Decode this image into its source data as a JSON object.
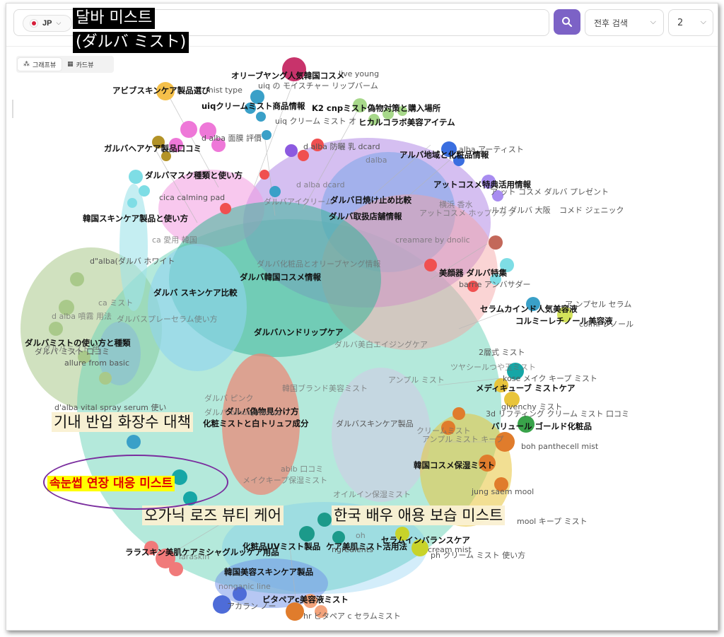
{
  "header": {
    "country_code": "JP",
    "query_line1": "달바 미스트",
    "query_line2": "(ダルバ ミスト)",
    "period_select": "전후 검색",
    "count_select": "2"
  },
  "view_toggle": {
    "graph_view": "그래프뷰",
    "card_view": "카드뷰"
  },
  "colors": {
    "accent": "#7c62c6",
    "highlight_text": "#e00000",
    "highlight_bg": "#ffff00",
    "circle_outline": "#7a2d9e"
  },
  "graph": {
    "bold_labels": [
      "オリーブヤング人気韓国コスメ",
      "アビブスキンケア製品選び",
      "uiqクリームミスト商品情報",
      "K2 cnpミスト偽物対策と購入場所",
      "ヒカルコラボ美容アイテム",
      "ガルバヘアケア製品口コミ",
      "アルバ地域と化粧品情報",
      "ダルバマスク種類と使い方",
      "アットコスメ特典活用情報",
      "韓国スキンケア製品と使い方",
      "ダルバ日焼け止め比較",
      "ダルバ取扱店舗情報",
      "ダルバ化粧品とオリーブヤング情報",
      "ダルバ韓国コスメ情報",
      "美顔器 ダルバ特集",
      "ダルバ スキンケア比較",
      "セラムカインド人気美容液",
      "コルミーレチノール美容液",
      "ダルバハンドリップケア",
      "ダルバミストの使い方と種類",
      "ダルバ美白エイジングケア",
      "メディキューブ ミストケア",
      "ダルバ偽物見分け方",
      "化粧ミストと白トリュフ成分",
      "ダルバスキンケア製品",
      "バリュール ゴールド化粧品",
      "韓国コスメ保湿ミスト",
      "オイルイン保湿ミスト",
      "セラムインバランスケア",
      "ララスキン美肌ケアミシャグルッケア用品",
      "化粧品UVミスト製品",
      "ケア美肌ミスト活用法",
      "韓国美容スキンケア製品",
      "ビタペアc美容液ミスト"
    ],
    "normal_labels": [
      "live young",
      "uiq の モイスチャー リップバーム",
      "mist type",
      "uiq クリーム ミスト オ",
      "d alba 面膜 評價",
      "d alba 防曬 乳 dcard",
      "alba アーティスト",
      "ア ット コスメ ダルバ プレゼント",
      "ルガ ダルバ 大阪",
      "コメド ジェニック",
      "cica calming pad",
      "d\"alba(ダルバ ホワイト",
      "barrie アンバサダー",
      "ア ンプセル セラム",
      "colmi レノール",
      "2層式 ミスト",
      "kose メイク キープ ミスト",
      "givenchy ミスト",
      "3d リフティング クリーム ミスト 口コミ",
      "boh panthecell mist",
      "jung saem mool",
      "mool キープ ミスト",
      "ngredients",
      "cream mist",
      "ph クリーム ミスト 使い方",
      "allure from basic",
      "d'alba vital spray serum 使い",
      "ダルバ ミスト 口コミ",
      "アカラン ノー",
      "hr ビタペア c セラムミスト"
    ],
    "faded_labels": [
      "ca 愛用 韓国",
      "ca ミスト",
      "d alba 噴霧 用法",
      "ダルバスプレーセラム使い方",
      "ダルバミスト 色",
      "d alba dcard",
      "ダルバアイクリーム",
      "dalba",
      "creamare by dnolic",
      "横浜 香水",
      "アットコスメ ホップアップ",
      "ダルバ bihuapinkoss",
      "韓国ブランド美容ミスト",
      "ツヤシールつや玉ミスト",
      "アンプル ミスト",
      "ダルバ ピンク",
      "クリームミスト",
      "アンプル ミスト キープ",
      "メイクキープ保湿ミスト",
      "abib 口コミ",
      "laraskin",
      "nonganic line",
      "oh"
    ],
    "big_labels": [
      "기내 반입 화장수 대책",
      "오가닉 로즈 뷰티 케어",
      "한국 배우 애용 보습 미스트"
    ],
    "highlight_label": "속눈썹 연장 대응 미스트"
  }
}
